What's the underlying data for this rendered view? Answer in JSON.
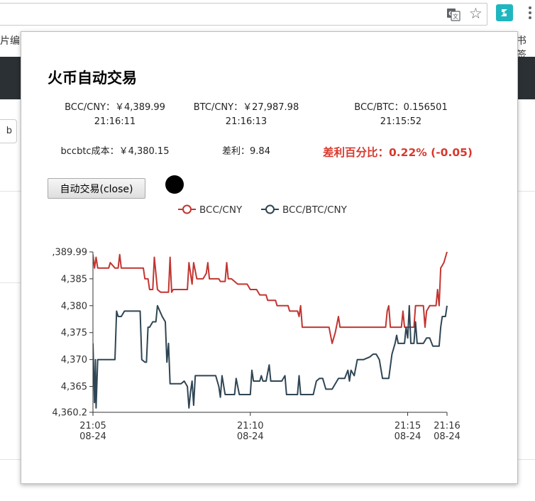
{
  "browser": {
    "bookmarks_left": "片编",
    "bookmarks_right": "书签",
    "icons": [
      "translate-icon",
      "star-icon",
      "extension-icon",
      "menu-icon"
    ]
  },
  "background_page": {
    "button_label": "b"
  },
  "popup": {
    "title": "火币自动交易",
    "stats": {
      "bcc_cny": "BCC/CNY：￥4,389.99",
      "bcc_cny_time": "21:16:11",
      "btc_cny": "BTC/CNY：￥27,987.98",
      "btc_cny_time": "21:16:13",
      "bcc_btc": "BCC/BTC：0.156501",
      "bcc_btc_time": "21:15:52",
      "cost": "bccbtc成本：￥4,380.15",
      "diff": "差利：9.84",
      "diff_pct": "差利百分比：0.22% (-0.05)"
    },
    "auto_button_label": "自动交易(close)",
    "status_dot_color": "#000000"
  },
  "chart_data": {
    "type": "line",
    "ylim": [
      4360.2,
      4389.99
    ],
    "yticks": [
      4360.2,
      4365,
      4370,
      4375,
      4380,
      4385,
      4389.99
    ],
    "ytick_labels": [
      "4,360.2",
      "4,365",
      "4,370",
      "4,375",
      "4,380",
      "4,385",
      ",389.99"
    ],
    "xticks": [
      {
        "t": 0,
        "time": "21:05",
        "date": "08-24"
      },
      {
        "t": 5,
        "time": "21:10",
        "date": "08-24"
      },
      {
        "t": 10,
        "time": "21:15",
        "date": "08-24"
      },
      {
        "t": 11.25,
        "time": "21:16",
        "date": "08-24"
      }
    ],
    "xlim": [
      0,
      11.25
    ],
    "legend_position": "top",
    "series": [
      {
        "name": "BCC/CNY",
        "color": "#c23531",
        "points": [
          [
            0,
            4389.5
          ],
          [
            0.05,
            4387
          ],
          [
            0.1,
            4389
          ],
          [
            0.15,
            4387
          ],
          [
            0.3,
            4387
          ],
          [
            0.5,
            4387
          ],
          [
            0.55,
            4388
          ],
          [
            0.7,
            4387
          ],
          [
            0.8,
            4387
          ],
          [
            0.85,
            4389.5
          ],
          [
            0.9,
            4387
          ],
          [
            1,
            4387
          ],
          [
            1.3,
            4387
          ],
          [
            1.6,
            4387
          ],
          [
            1.65,
            4385
          ],
          [
            1.75,
            4385
          ],
          [
            1.8,
            4383
          ],
          [
            1.9,
            4383
          ],
          [
            1.95,
            4389
          ],
          [
            2.05,
            4383
          ],
          [
            2.15,
            4382.5
          ],
          [
            2.4,
            4382.5
          ],
          [
            2.45,
            4389
          ],
          [
            2.5,
            4382.5
          ],
          [
            2.55,
            4383
          ],
          [
            3,
            4383
          ],
          [
            3.05,
            4388
          ],
          [
            3.15,
            4384
          ],
          [
            3.2,
            4388
          ],
          [
            3.3,
            4385
          ],
          [
            3.5,
            4385
          ],
          [
            3.6,
            4386
          ],
          [
            3.65,
            4388
          ],
          [
            3.7,
            4385
          ],
          [
            3.75,
            4385
          ],
          [
            4,
            4385
          ],
          [
            4.05,
            4384.5
          ],
          [
            4.2,
            4384.5
          ],
          [
            4.25,
            4388
          ],
          [
            4.3,
            4385
          ],
          [
            4.4,
            4385
          ],
          [
            4.6,
            4384
          ],
          [
            4.9,
            4384
          ],
          [
            5,
            4383
          ],
          [
            5.2,
            4383
          ],
          [
            5.3,
            4382
          ],
          [
            5.5,
            4382
          ],
          [
            5.55,
            4381
          ],
          [
            5.8,
            4381
          ],
          [
            5.85,
            4380
          ],
          [
            6.2,
            4380
          ],
          [
            6.25,
            4379
          ],
          [
            6.5,
            4379
          ],
          [
            6.55,
            4378
          ],
          [
            6.6,
            4380
          ],
          [
            6.65,
            4376
          ],
          [
            7,
            4376
          ],
          [
            7.3,
            4376
          ],
          [
            7.5,
            4376
          ],
          [
            7.6,
            4373
          ],
          [
            7.7,
            4375
          ],
          [
            7.8,
            4378
          ],
          [
            7.85,
            4376
          ],
          [
            8,
            4376
          ],
          [
            8.5,
            4376
          ],
          [
            9.3,
            4376
          ],
          [
            9.35,
            4379
          ],
          [
            9.4,
            4380
          ],
          [
            9.45,
            4376
          ],
          [
            9.5,
            4376
          ],
          [
            9.8,
            4376
          ],
          [
            9.85,
            4379
          ],
          [
            9.9,
            4376
          ],
          [
            10,
            4376
          ],
          [
            10.1,
            4376
          ],
          [
            10.2,
            4376
          ],
          [
            10.25,
            4380
          ],
          [
            10.5,
            4380
          ],
          [
            10.55,
            4376
          ],
          [
            10.6,
            4379
          ],
          [
            10.7,
            4380
          ],
          [
            10.9,
            4380
          ],
          [
            10.95,
            4383
          ],
          [
            11,
            4380
          ],
          [
            11.05,
            4387
          ],
          [
            11.15,
            4388
          ],
          [
            11.25,
            4390
          ]
        ]
      },
      {
        "name": "BCC/BTC/CNY",
        "color": "#2f4554",
        "points": [
          [
            0,
            4373
          ],
          [
            0.05,
            4362
          ],
          [
            0.08,
            4370
          ],
          [
            0.1,
            4361
          ],
          [
            0.15,
            4370
          ],
          [
            0.4,
            4370
          ],
          [
            0.7,
            4370
          ],
          [
            0.75,
            4379
          ],
          [
            0.8,
            4378
          ],
          [
            0.9,
            4378
          ],
          [
            1,
            4379
          ],
          [
            1.3,
            4379
          ],
          [
            1.5,
            4379
          ],
          [
            1.55,
            4370
          ],
          [
            1.65,
            4369.5
          ],
          [
            1.7,
            4369.5
          ],
          [
            1.75,
            4376
          ],
          [
            1.8,
            4376
          ],
          [
            1.9,
            4377
          ],
          [
            2,
            4377
          ],
          [
            2.05,
            4380
          ],
          [
            2.2,
            4378
          ],
          [
            2.3,
            4377
          ],
          [
            2.35,
            4369.5
          ],
          [
            2.4,
            4373
          ],
          [
            2.45,
            4365.5
          ],
          [
            2.6,
            4365.5
          ],
          [
            2.8,
            4365.5
          ],
          [
            2.9,
            4366
          ],
          [
            3,
            4365
          ],
          [
            3.05,
            4361
          ],
          [
            3.1,
            4364
          ],
          [
            3.15,
            4366
          ],
          [
            3.2,
            4361.5
          ],
          [
            3.25,
            4367
          ],
          [
            3.3,
            4367
          ],
          [
            3.6,
            4367
          ],
          [
            3.9,
            4367
          ],
          [
            4,
            4365
          ],
          [
            4.05,
            4363
          ],
          [
            4.1,
            4367
          ],
          [
            4.2,
            4363.5
          ],
          [
            4.3,
            4363.5
          ],
          [
            4.5,
            4363.5
          ],
          [
            4.55,
            4366.5
          ],
          [
            4.65,
            4363.5
          ],
          [
            4.8,
            4363.5
          ],
          [
            5,
            4363.5
          ],
          [
            5.05,
            4368
          ],
          [
            5.1,
            4366
          ],
          [
            5.3,
            4366
          ],
          [
            5.35,
            4367
          ],
          [
            5.4,
            4366
          ],
          [
            5.5,
            4366
          ],
          [
            5.6,
            4369
          ],
          [
            5.65,
            4366
          ],
          [
            6,
            4366
          ],
          [
            6.1,
            4367
          ],
          [
            6.15,
            4363.5
          ],
          [
            6.5,
            4363.5
          ],
          [
            6.55,
            4367
          ],
          [
            6.6,
            4363.5
          ],
          [
            7,
            4363.5
          ],
          [
            7.1,
            4366
          ],
          [
            7.2,
            4366.5
          ],
          [
            7.3,
            4366.5
          ],
          [
            7.4,
            4364.5
          ],
          [
            7.6,
            4364.5
          ],
          [
            7.8,
            4366.5
          ],
          [
            8,
            4366.5
          ],
          [
            8.1,
            4368
          ],
          [
            8.15,
            4366
          ],
          [
            8.2,
            4368
          ],
          [
            8.3,
            4367
          ],
          [
            8.4,
            4370
          ],
          [
            8.6,
            4370
          ],
          [
            8.8,
            4370.5
          ],
          [
            8.9,
            4371
          ],
          [
            9,
            4371
          ],
          [
            9.1,
            4370
          ],
          [
            9.2,
            4366.5
          ],
          [
            9.4,
            4366.5
          ],
          [
            9.5,
            4371
          ],
          [
            9.6,
            4373
          ],
          [
            9.65,
            4374.5
          ],
          [
            9.7,
            4373
          ],
          [
            9.8,
            4373
          ],
          [
            9.9,
            4373
          ],
          [
            9.95,
            4376
          ],
          [
            10,
            4374
          ],
          [
            10.05,
            4380
          ],
          [
            10.1,
            4373
          ],
          [
            10.2,
            4373
          ],
          [
            10.25,
            4377
          ],
          [
            10.3,
            4373
          ],
          [
            10.5,
            4373
          ],
          [
            10.6,
            4374
          ],
          [
            10.7,
            4374
          ],
          [
            10.8,
            4372.5
          ],
          [
            11,
            4372.5
          ],
          [
            11.05,
            4376
          ],
          [
            11.1,
            4378
          ],
          [
            11.15,
            4378
          ],
          [
            11.2,
            4378
          ],
          [
            11.25,
            4380
          ]
        ]
      }
    ]
  }
}
